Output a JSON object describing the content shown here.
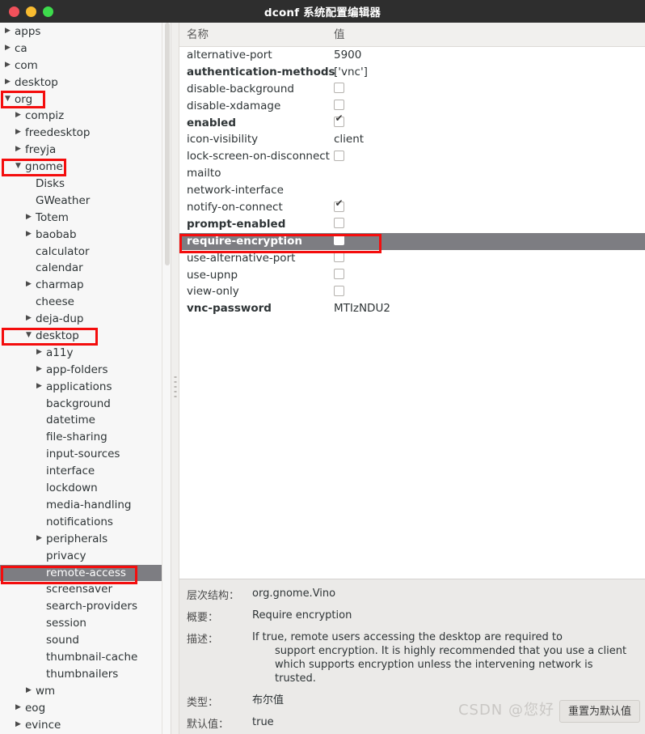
{
  "window": {
    "title": "dconf 系统配置编辑器",
    "controls": [
      "close",
      "minimize",
      "maximize"
    ]
  },
  "sidebar": {
    "items": [
      {
        "label": "apps",
        "depth": 0,
        "twisty": "collapsed",
        "selected": false
      },
      {
        "label": "ca",
        "depth": 0,
        "twisty": "collapsed",
        "selected": false
      },
      {
        "label": "com",
        "depth": 0,
        "twisty": "collapsed",
        "selected": false
      },
      {
        "label": "desktop",
        "depth": 0,
        "twisty": "collapsed",
        "selected": false
      },
      {
        "label": "org",
        "depth": 0,
        "twisty": "expanded",
        "selected": false
      },
      {
        "label": "compiz",
        "depth": 1,
        "twisty": "collapsed",
        "selected": false
      },
      {
        "label": "freedesktop",
        "depth": 1,
        "twisty": "collapsed",
        "selected": false
      },
      {
        "label": "freyja",
        "depth": 1,
        "twisty": "collapsed",
        "selected": false
      },
      {
        "label": "gnome",
        "depth": 1,
        "twisty": "expanded",
        "selected": false
      },
      {
        "label": "Disks",
        "depth": 2,
        "twisty": "none",
        "selected": false
      },
      {
        "label": "GWeather",
        "depth": 2,
        "twisty": "none",
        "selected": false
      },
      {
        "label": "Totem",
        "depth": 2,
        "twisty": "collapsed",
        "selected": false
      },
      {
        "label": "baobab",
        "depth": 2,
        "twisty": "collapsed",
        "selected": false
      },
      {
        "label": "calculator",
        "depth": 2,
        "twisty": "none",
        "selected": false
      },
      {
        "label": "calendar",
        "depth": 2,
        "twisty": "none",
        "selected": false
      },
      {
        "label": "charmap",
        "depth": 2,
        "twisty": "collapsed",
        "selected": false
      },
      {
        "label": "cheese",
        "depth": 2,
        "twisty": "none",
        "selected": false
      },
      {
        "label": "deja-dup",
        "depth": 2,
        "twisty": "collapsed",
        "selected": false
      },
      {
        "label": "desktop",
        "depth": 2,
        "twisty": "expanded",
        "selected": false
      },
      {
        "label": "a11y",
        "depth": 3,
        "twisty": "collapsed",
        "selected": false
      },
      {
        "label": "app-folders",
        "depth": 3,
        "twisty": "collapsed",
        "selected": false
      },
      {
        "label": "applications",
        "depth": 3,
        "twisty": "collapsed",
        "selected": false
      },
      {
        "label": "background",
        "depth": 3,
        "twisty": "none",
        "selected": false
      },
      {
        "label": "datetime",
        "depth": 3,
        "twisty": "none",
        "selected": false
      },
      {
        "label": "file-sharing",
        "depth": 3,
        "twisty": "none",
        "selected": false
      },
      {
        "label": "input-sources",
        "depth": 3,
        "twisty": "none",
        "selected": false
      },
      {
        "label": "interface",
        "depth": 3,
        "twisty": "none",
        "selected": false
      },
      {
        "label": "lockdown",
        "depth": 3,
        "twisty": "none",
        "selected": false
      },
      {
        "label": "media-handling",
        "depth": 3,
        "twisty": "none",
        "selected": false
      },
      {
        "label": "notifications",
        "depth": 3,
        "twisty": "none",
        "selected": false
      },
      {
        "label": "peripherals",
        "depth": 3,
        "twisty": "collapsed",
        "selected": false
      },
      {
        "label": "privacy",
        "depth": 3,
        "twisty": "none",
        "selected": false
      },
      {
        "label": "remote-access",
        "depth": 3,
        "twisty": "none",
        "selected": true
      },
      {
        "label": "screensaver",
        "depth": 3,
        "twisty": "none",
        "selected": false
      },
      {
        "label": "search-providers",
        "depth": 3,
        "twisty": "none",
        "selected": false
      },
      {
        "label": "session",
        "depth": 3,
        "twisty": "none",
        "selected": false
      },
      {
        "label": "sound",
        "depth": 3,
        "twisty": "none",
        "selected": false
      },
      {
        "label": "thumbnail-cache",
        "depth": 3,
        "twisty": "none",
        "selected": false
      },
      {
        "label": "thumbnailers",
        "depth": 3,
        "twisty": "none",
        "selected": false
      },
      {
        "label": "wm",
        "depth": 2,
        "twisty": "collapsed",
        "selected": false
      },
      {
        "label": "eog",
        "depth": 1,
        "twisty": "collapsed",
        "selected": false
      },
      {
        "label": "evince",
        "depth": 1,
        "twisty": "collapsed",
        "selected": false
      }
    ]
  },
  "list": {
    "columns": {
      "name": "名称",
      "value": "值"
    },
    "rows": [
      {
        "name": "alternative-port",
        "bold": false,
        "type": "text",
        "value": "5900",
        "checked": false,
        "selected": false
      },
      {
        "name": "authentication-methods",
        "bold": true,
        "type": "text",
        "value": "['vnc']",
        "checked": false,
        "selected": false
      },
      {
        "name": "disable-background",
        "bold": false,
        "type": "checkbox",
        "value": "",
        "checked": false,
        "selected": false
      },
      {
        "name": "disable-xdamage",
        "bold": false,
        "type": "checkbox",
        "value": "",
        "checked": false,
        "selected": false
      },
      {
        "name": "enabled",
        "bold": true,
        "type": "checkbox",
        "value": "",
        "checked": true,
        "selected": false
      },
      {
        "name": "icon-visibility",
        "bold": false,
        "type": "text",
        "value": "client",
        "checked": false,
        "selected": false
      },
      {
        "name": "lock-screen-on-disconnect",
        "bold": false,
        "type": "checkbox",
        "value": "",
        "checked": false,
        "selected": false
      },
      {
        "name": "mailto",
        "bold": false,
        "type": "text",
        "value": "",
        "checked": false,
        "selected": false
      },
      {
        "name": "network-interface",
        "bold": false,
        "type": "text",
        "value": "",
        "checked": false,
        "selected": false
      },
      {
        "name": "notify-on-connect",
        "bold": false,
        "type": "checkbox",
        "value": "",
        "checked": true,
        "selected": false
      },
      {
        "name": "prompt-enabled",
        "bold": true,
        "type": "checkbox",
        "value": "",
        "checked": false,
        "selected": false
      },
      {
        "name": "require-encryption",
        "bold": true,
        "type": "checkbox",
        "value": "",
        "checked": false,
        "selected": true
      },
      {
        "name": "use-alternative-port",
        "bold": false,
        "type": "checkbox",
        "value": "",
        "checked": false,
        "selected": false
      },
      {
        "name": "use-upnp",
        "bold": false,
        "type": "checkbox",
        "value": "",
        "checked": false,
        "selected": false
      },
      {
        "name": "view-only",
        "bold": false,
        "type": "checkbox",
        "value": "",
        "checked": false,
        "selected": false
      },
      {
        "name": "vnc-password",
        "bold": true,
        "type": "text",
        "value": "MTIzNDU2",
        "checked": false,
        "selected": false
      }
    ]
  },
  "detail": {
    "schema_label": "层次结构：",
    "schema_value": "org.gnome.Vino",
    "summary_label": "概要：",
    "summary_value": "Require encryption",
    "description_label": "描述：",
    "description_line1": "If true, remote users accessing the desktop are required to",
    "description_rest": "support encryption. It is highly recommended that you use a client which supports encryption unless the intervening network is trusted.",
    "type_label": "类型：",
    "type_value": "布尔值",
    "default_label": "默认值：",
    "default_value": "true",
    "reset_button": "重置为默认值"
  },
  "watermark": {
    "text": "CSDN @您好"
  },
  "colors": {
    "titlebar": "#2e2e2e",
    "selection": "#7d7d82",
    "annotation": "#f40d0d",
    "detail_bg": "#ebeae8"
  }
}
